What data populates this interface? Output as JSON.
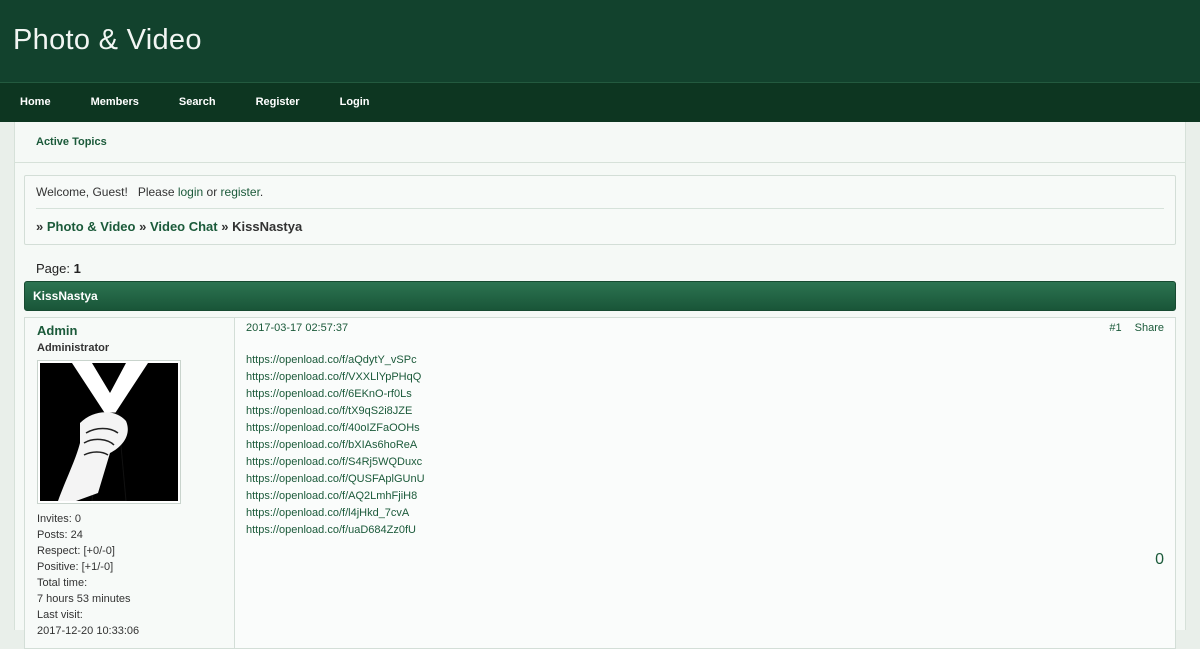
{
  "site": {
    "title": "Photo & Video"
  },
  "nav": {
    "items": [
      "Home",
      "Members",
      "Search",
      "Register",
      "Login"
    ]
  },
  "subnav": {
    "active_topics": "Active Topics"
  },
  "welcome": {
    "prefix": "Welcome, Guest!   Please ",
    "login": "login",
    "or": " or ",
    "register": "register",
    "suffix": "."
  },
  "breadcrumb": {
    "sep": "»",
    "items": [
      "Photo & Video",
      "Video Chat"
    ],
    "current": "KissNastya"
  },
  "pager": {
    "label": "Page:",
    "current": "1"
  },
  "topic": {
    "title": "KissNastya"
  },
  "post": {
    "author": "Admin",
    "role": "Administrator",
    "stats": [
      "Invites: 0",
      "Posts: 24",
      "Respect: [+0/-0]",
      "Positive: [+1/-0]",
      "Total time:",
      "7 hours 53 minutes",
      "Last visit:",
      "2017-12-20 10:33:06"
    ],
    "date": "2017-03-17 02:57:37",
    "number": "#1",
    "share": "Share",
    "links": [
      "https://openload.co/f/aQdytY_vSPc",
      "https://openload.co/f/VXXLlYpPHqQ",
      "https://openload.co/f/6EKnO-rf0Ls",
      "https://openload.co/f/tX9qS2i8JZE",
      "https://openload.co/f/40oIZFaOOHs",
      "https://openload.co/f/bXIAs6hoReA",
      "https://openload.co/f/S4Rj5WQDuxc",
      "https://openload.co/f/QUSFAplGUnU",
      "https://openload.co/f/AQ2LmhFjiH8",
      "https://openload.co/f/l4jHkd_7cvA",
      "https://openload.co/f/uaD684Zz0fU"
    ],
    "vote": "0"
  },
  "colors": {
    "header": "#12422d",
    "nav": "#0d3621",
    "link": "#1b5a3a"
  }
}
